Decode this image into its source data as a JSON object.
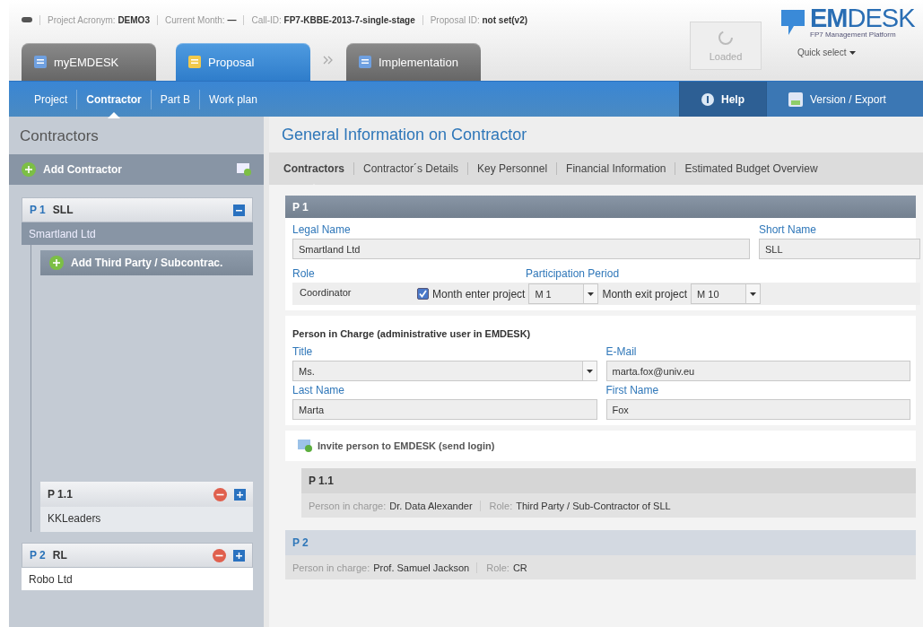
{
  "info_bar": [
    {
      "label": "Project Acronym:",
      "value": "DEMO3"
    },
    {
      "label": "Current Month:",
      "value": "—"
    },
    {
      "label": "Call-ID:",
      "value": "FP7-KBBE-2013-7-single-stage"
    },
    {
      "label": "Proposal ID:",
      "value": "not set(v2)"
    }
  ],
  "main_tabs": [
    {
      "label": "myEMDESK",
      "selected": false
    },
    {
      "label": "Proposal",
      "selected": true
    },
    {
      "label": "Implementation",
      "selected": false
    }
  ],
  "status_button": {
    "label": "Loaded",
    "disabled": true
  },
  "logo": {
    "name": "**EM**DESK",
    "tagline": "FP7 Management Platform"
  },
  "quick_select": "Quick select",
  "nav": [
    {
      "label": "Project",
      "selected": false
    },
    {
      "label": "Contractor",
      "selected": true
    },
    {
      "label": "Part B",
      "selected": false
    },
    {
      "label": "Work plan",
      "selected": false
    }
  ],
  "nav_actions": [
    {
      "label": "Help",
      "kind": "help"
    },
    {
      "label": "Version / Export",
      "kind": "export"
    }
  ],
  "sidebar": {
    "title": "Contractors",
    "add_label": "Add Contractor",
    "contractors": [
      {
        "code": "P 1",
        "short": "SLL",
        "name": "Smartland Ltd",
        "selected": true,
        "expanded": true,
        "removable": false,
        "add_child_label": "Add Third Party / Subcontrac.",
        "children": [
          {
            "code": "P 1.1",
            "name": "KKLeaders",
            "removable": true
          }
        ]
      },
      {
        "code": "P 2",
        "short": "RL",
        "name": "Robo Ltd",
        "selected": false,
        "expanded": false,
        "removable": true
      }
    ]
  },
  "page_title": "General Information on Contractor",
  "sub_tabs": [
    {
      "label": "Contractors",
      "selected": true
    },
    {
      "label": "Contractor´s Details",
      "selected": false
    },
    {
      "label": "Key Personnel",
      "selected": false
    },
    {
      "label": "Financial Information",
      "selected": false
    },
    {
      "label": "Estimated Budget Overview",
      "selected": false
    }
  ],
  "contractor_form": {
    "header": "P 1",
    "legal_name": {
      "label": "Legal Name",
      "value": "Smartland Ltd"
    },
    "short_name": {
      "label": "Short Name",
      "value": "SLL"
    },
    "role": {
      "label": "Role",
      "value": "Coordinator"
    },
    "participation": {
      "label": "Participation Period",
      "checked": true,
      "enter_label": "Month enter project",
      "enter_value": "M 1",
      "exit_label": "Month exit project",
      "exit_value": "M 10"
    }
  },
  "person": {
    "heading": "Person in Charge (administrative user in EMDESK)",
    "fields": [
      {
        "label": "Title",
        "value": "Ms.",
        "kind": "select"
      },
      {
        "label": "E-Mail",
        "value": "marta.fox@univ.eu",
        "kind": "text"
      },
      {
        "label": "Last Name",
        "value": "Marta",
        "kind": "text"
      },
      {
        "label": "First Name",
        "value": "Fox",
        "kind": "text"
      }
    ]
  },
  "invite_label": "Invite person to EMDESK (send login)",
  "summaries": [
    {
      "code": "P 1.1",
      "kind": "sub",
      "person_label": "Person in charge:",
      "person": "Dr. Data Alexander",
      "role_label": "Role:",
      "role": "Third Party / Sub-Contractor of SLL"
    },
    {
      "code": "P 2",
      "kind": "main",
      "person_label": "Person in charge:",
      "person": "Prof. Samuel Jackson",
      "role_label": "Role:",
      "role": "CR"
    }
  ]
}
